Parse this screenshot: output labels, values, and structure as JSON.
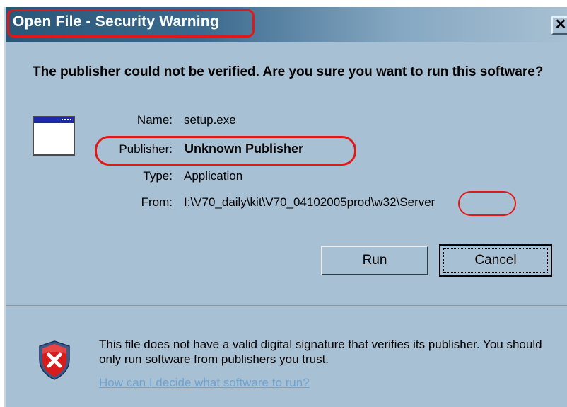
{
  "window": {
    "title": "Open File - Security Warning",
    "close_glyph": "✕"
  },
  "dialog": {
    "heading": "The publisher could not be verified.  Are you sure you want to run this software?",
    "icon": "application-window-icon",
    "fields": {
      "name_label": "Name:",
      "name_value": "setup.exe",
      "publisher_label": "Publisher:",
      "publisher_value": "Unknown Publisher",
      "type_label": "Type:",
      "type_value": "Application",
      "from_label": "From:",
      "from_value": "I:\\V70_daily\\kit\\V70_04102005prod\\w32\\Server"
    },
    "buttons": {
      "run_label_accel": "R",
      "run_label_rest": "un",
      "cancel_label": "Cancel"
    },
    "warning": {
      "icon": "shield-error-icon",
      "text": "This file does not have a valid digital signature that verifies its publisher.  You should only run software from publishers you trust.",
      "link_text": "How can I decide what software to run?"
    }
  },
  "colors": {
    "dialog_bg": "#a8c0d3",
    "titlebar_dark": "#2a5678",
    "annotation_red": "#e01818",
    "link": "#6fa3d0"
  }
}
